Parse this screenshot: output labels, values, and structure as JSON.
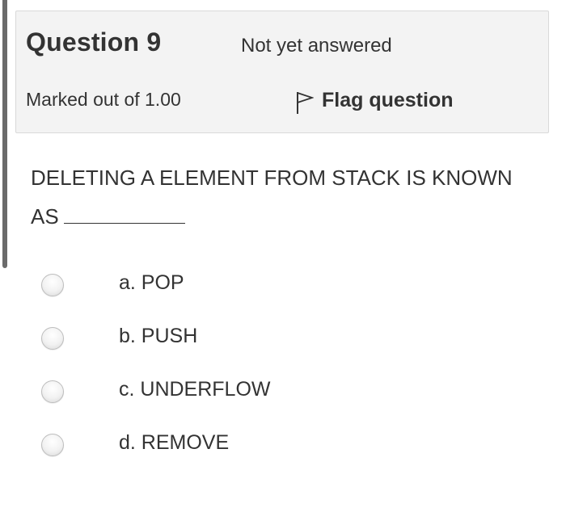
{
  "question": {
    "number_label": "Question 9",
    "state": "Not yet answered",
    "grade": "Marked out of 1.00",
    "flag_label": "Flag question",
    "flag_icon": "flag-icon",
    "text": "DELETING A ELEMENT FROM STACK IS KNOWN AS"
  },
  "answers": [
    {
      "label": "a. POP"
    },
    {
      "label": "b. PUSH"
    },
    {
      "label": "c. UNDERFLOW"
    },
    {
      "label": "d. REMOVE"
    }
  ],
  "colors": {
    "info_background": "#f3f3f3",
    "text": "#333333",
    "left_bar": "#6b6b6b"
  }
}
